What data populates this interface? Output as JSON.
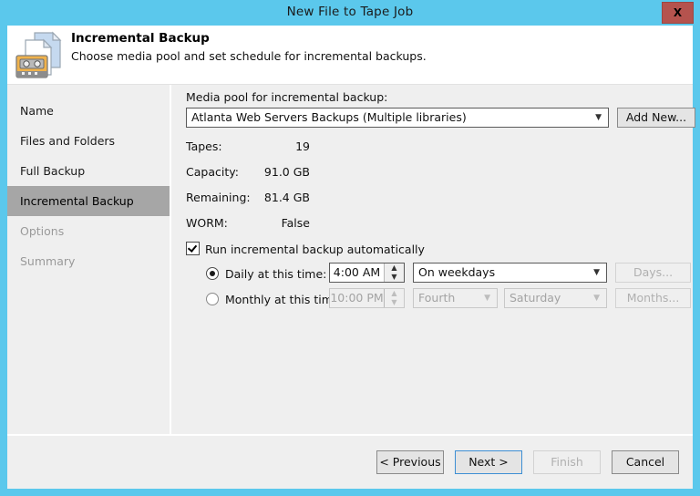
{
  "window": {
    "title": "New File to Tape Job",
    "close_label": "X",
    "titlebar_color": "#5bc8ec",
    "close_color": "#b5534e"
  },
  "header": {
    "title": "Incremental Backup",
    "subtitle": "Choose media pool and set schedule for incremental backups.",
    "icon": "tape-document-icon"
  },
  "sidebar": {
    "items": [
      {
        "label": "Name",
        "state": "enabled"
      },
      {
        "label": "Files and Folders",
        "state": "enabled"
      },
      {
        "label": "Full Backup",
        "state": "enabled"
      },
      {
        "label": "Incremental Backup",
        "state": "selected"
      },
      {
        "label": "Options",
        "state": "disabled"
      },
      {
        "label": "Summary",
        "state": "disabled"
      }
    ],
    "selected_color": "#a6a6a6"
  },
  "main": {
    "media_pool_label": "Media pool for incremental backup:",
    "media_pool_value": "Atlanta Web Servers Backups (Multiple libraries)",
    "add_new_label": "Add New...",
    "info_rows": [
      {
        "key": "Tapes:",
        "value": "19"
      },
      {
        "key": "Capacity:",
        "value": "91.0 GB"
      },
      {
        "key": "Remaining:",
        "value": "81.4 GB"
      },
      {
        "key": "WORM:",
        "value": "False"
      }
    ],
    "run_auto_label": "Run incremental backup automatically",
    "run_auto_checked": true,
    "daily": {
      "label": "Daily at this time:",
      "selected": true,
      "time": "4:00 AM",
      "frequency": "On weekdays",
      "days_button": "Days...",
      "days_enabled": false
    },
    "monthly": {
      "label": "Monthly at this time:",
      "selected": false,
      "time": "10:00 PM",
      "week": "Fourth",
      "weekday": "Saturday",
      "months_button": "Months...",
      "enabled": false
    }
  },
  "footer": {
    "previous": "< Previous",
    "next": "Next >",
    "finish": "Finish",
    "cancel": "Cancel",
    "finish_enabled": false
  }
}
